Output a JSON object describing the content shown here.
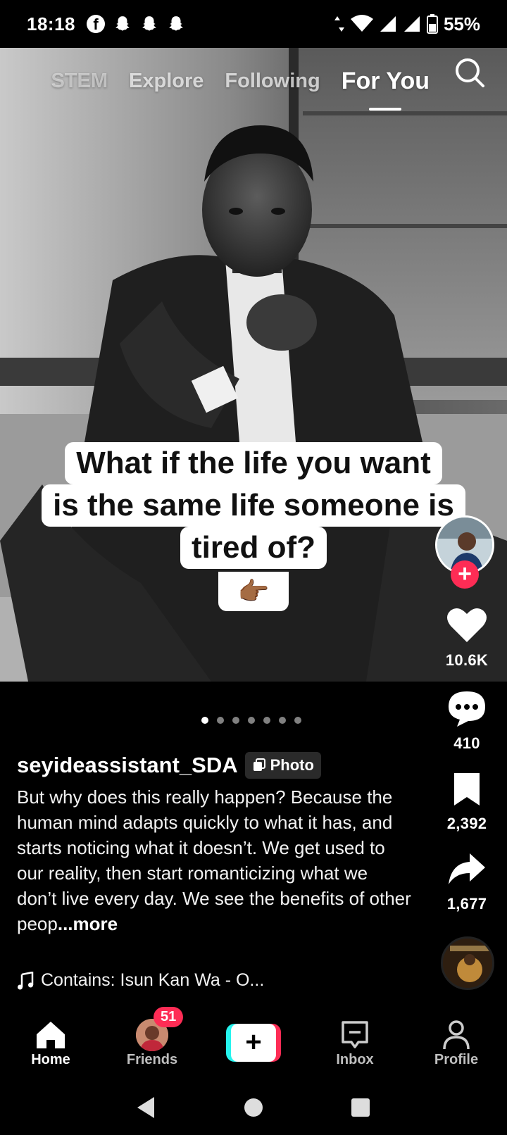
{
  "status_bar": {
    "time": "18:18",
    "battery": "55%",
    "notification_icons": [
      "facebook-icon",
      "snapchat-icon",
      "snapchat-icon",
      "snapchat-icon"
    ]
  },
  "top_tabs": {
    "items": [
      {
        "label": "STEM",
        "active": false
      },
      {
        "label": "Explore",
        "active": false
      },
      {
        "label": "Following",
        "active": false
      },
      {
        "label": "For You",
        "active": true
      }
    ]
  },
  "post": {
    "caption_lines": [
      "What if the life you want",
      "is the same life someone is",
      "tired of?"
    ],
    "caption_emoji": "👉🏾",
    "likes": "10.6K",
    "comments": "410",
    "saves": "2,392",
    "shares": "1,677",
    "carousel_count": 7,
    "carousel_index": 0,
    "author": "seyideassistant_SDA",
    "type_badge": "Photo",
    "description": "But why does this really happen? Because the human mind adapts quickly to what it has, and starts noticing what it doesn’t. We get used to our reality, then start romanticizing what we don’t live every day. We see the benefits of other peop",
    "more_label": "...more",
    "music": "Contains: Isun Kan Wa - O..."
  },
  "bottom_nav": {
    "items": [
      {
        "label": "Home",
        "icon": "home-icon",
        "active": true
      },
      {
        "label": "Friends",
        "icon": "friends-avatar",
        "active": false
      },
      {
        "label": "",
        "icon": "create-icon",
        "active": false
      },
      {
        "label": "Inbox",
        "icon": "inbox-icon",
        "active": false
      },
      {
        "label": "Profile",
        "icon": "profile-icon",
        "active": false
      }
    ],
    "friends_badge": "51"
  },
  "colors": {
    "accent": "#fe2c55",
    "cyan": "#25f4ee",
    "background": "#000000"
  }
}
